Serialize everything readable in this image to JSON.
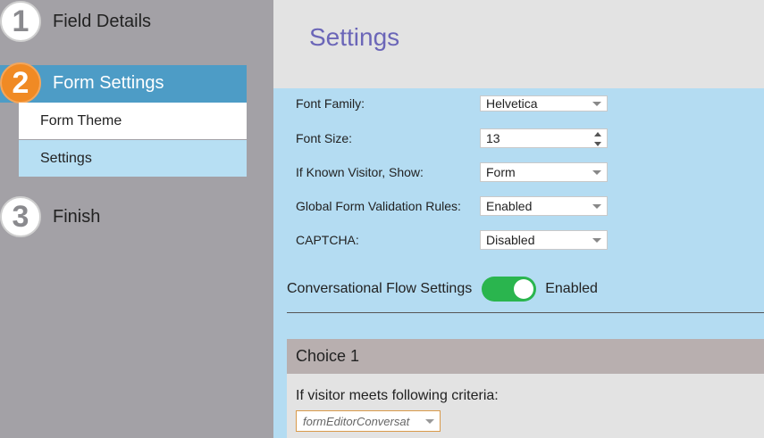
{
  "wizard": {
    "steps": [
      {
        "number": "1",
        "label": "Field Details"
      },
      {
        "number": "2",
        "label": "Form Settings"
      },
      {
        "number": "3",
        "label": "Finish"
      }
    ],
    "active_sub_items": [
      "Form Theme",
      "Settings"
    ]
  },
  "main": {
    "title": "Settings",
    "settings": [
      {
        "label": "Font Family:",
        "value": "Helvetica"
      },
      {
        "label": "Font Size:",
        "value": "13"
      },
      {
        "label": "If Known Visitor, Show:",
        "value": "Form"
      },
      {
        "label": "Global Form Validation Rules:",
        "value": "Enabled"
      },
      {
        "label": "CAPTCHA:",
        "value": "Disabled"
      }
    ],
    "conversational_flow": {
      "label": "Conversational Flow Settings",
      "status": "Enabled"
    },
    "choice": {
      "header": "Choice 1",
      "criteria_label": "If visitor meets following criteria:",
      "criteria_value": "formEditorConversat"
    }
  },
  "colors": {
    "active_step": "#f08a24",
    "active_bar": "#4d9cc6",
    "title": "#6b66b8",
    "toggle_on": "#2ab54e"
  }
}
